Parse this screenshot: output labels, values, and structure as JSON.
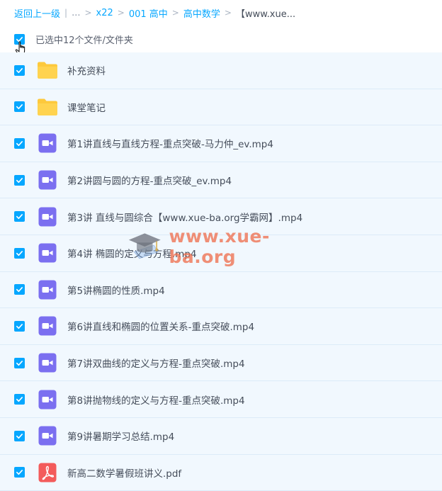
{
  "breadcrumb": {
    "back": "返回上一级",
    "ellipsis": "...",
    "items": [
      "x22",
      "001 高中",
      "高中数学"
    ],
    "current": "【www.xue..."
  },
  "selection": {
    "text": "已选中12个文件/文件夹"
  },
  "files": [
    {
      "name": "补充资料",
      "type": "folder"
    },
    {
      "name": "课堂笔记",
      "type": "folder"
    },
    {
      "name": "第1讲直线与直线方程-重点突破-马力仲_ev.mp4",
      "type": "video"
    },
    {
      "name": "第2讲圆与圆的方程-重点突破_ev.mp4",
      "type": "video"
    },
    {
      "name": "第3讲 直线与圆综合【www.xue-ba.org学霸网】.mp4",
      "type": "video"
    },
    {
      "name": "第4讲 椭圆的定义与方程.mp4",
      "type": "video"
    },
    {
      "name": "第5讲椭圆的性质.mp4",
      "type": "video"
    },
    {
      "name": "第6讲直线和椭圆的位置关系-重点突破.mp4",
      "type": "video"
    },
    {
      "name": "第7讲双曲线的定义与方程-重点突破.mp4",
      "type": "video"
    },
    {
      "name": "第8讲抛物线的定义与方程-重点突破.mp4",
      "type": "video"
    },
    {
      "name": "第9讲暑期学习总结.mp4",
      "type": "video"
    },
    {
      "name": "新高二数学暑假班讲义.pdf",
      "type": "pdf"
    }
  ],
  "watermark": {
    "text": "www.xue-ba.org"
  },
  "colors": {
    "accent": "#06a7ff",
    "row_bg": "#f1f8fe",
    "folder": "#fdc93c",
    "video": "#7b6ff0",
    "pdf": "#f35b5b"
  }
}
